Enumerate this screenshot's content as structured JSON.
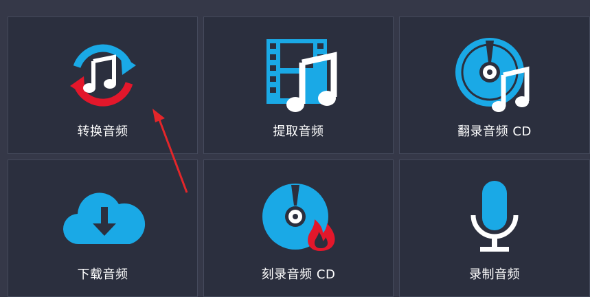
{
  "colors": {
    "background": "#353848",
    "tile": "#2b2f3e",
    "tile_border": "#454a5c",
    "accent_blue": "#1aa9e6",
    "accent_red": "#e3172b",
    "label": "#ffffff",
    "annotation_arrow": "#e3262a"
  },
  "tiles": [
    {
      "label": "转换音频",
      "icon": "convert-audio-icon"
    },
    {
      "label": "提取音频",
      "icon": "film-music-icon"
    },
    {
      "label": "翻录音频 CD",
      "icon": "cd-music-icon"
    },
    {
      "label": "下载音频",
      "icon": "cloud-download-icon"
    },
    {
      "label": "刻录音频 CD",
      "icon": "cd-burn-icon"
    },
    {
      "label": "录制音频",
      "icon": "microphone-icon"
    }
  ]
}
